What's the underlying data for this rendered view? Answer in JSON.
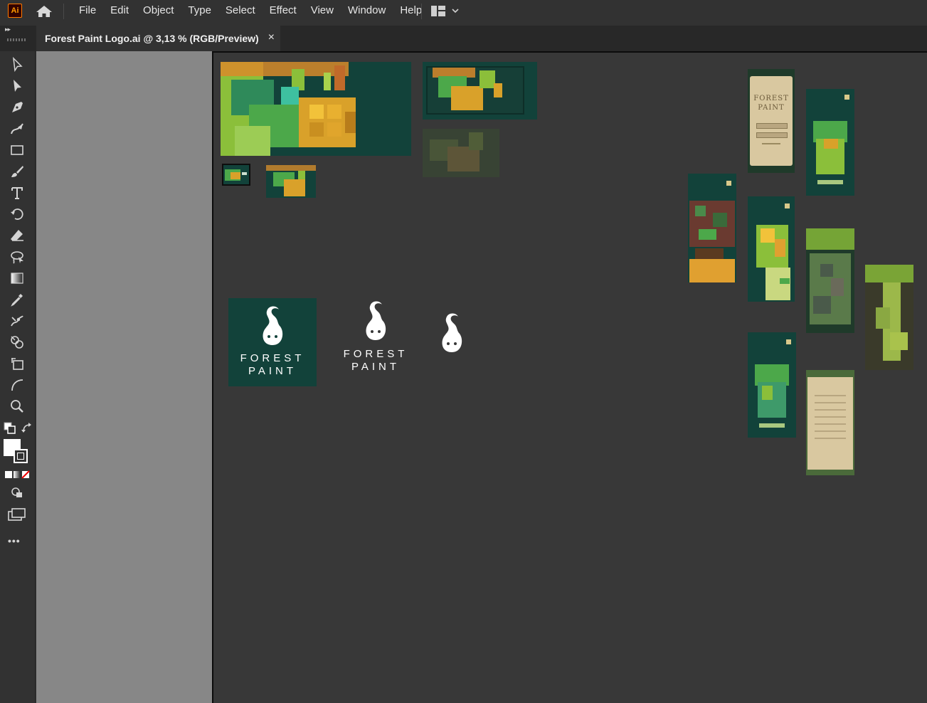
{
  "app": {
    "logo_text": "Ai",
    "menus": [
      "File",
      "Edit",
      "Object",
      "Type",
      "Select",
      "Effect",
      "View",
      "Window",
      "Help"
    ]
  },
  "document_tab": {
    "title": "Forest Paint Logo.ai @ 3,13 % (RGB/Preview)",
    "close_glyph": "×"
  },
  "toolbar": {
    "tools": [
      "selection-tool",
      "direct-selection-tool",
      "pen-tool",
      "curvature-tool",
      "rectangle-tool",
      "paintbrush-tool",
      "type-tool",
      "rotate-tool",
      "eraser-tool",
      "lasso-tool",
      "gradient-tool",
      "eyedropper-tool",
      "puppet-warp-tool",
      "shape-builder-tool",
      "artboard-tool",
      "width-tool",
      "zoom-tool"
    ],
    "more_glyph": "•••"
  },
  "canvas": {
    "logo_line1": "FOREST",
    "logo_line2": "PAINT",
    "mock_title_line1": "FOREST",
    "mock_title_line2": "PAINT"
  },
  "colors": {
    "forest_green": "#12423a",
    "ui_dark": "#323232",
    "canvas": "#383838",
    "pasteboard": "#878787",
    "accent_orange": "#ff9a00"
  }
}
